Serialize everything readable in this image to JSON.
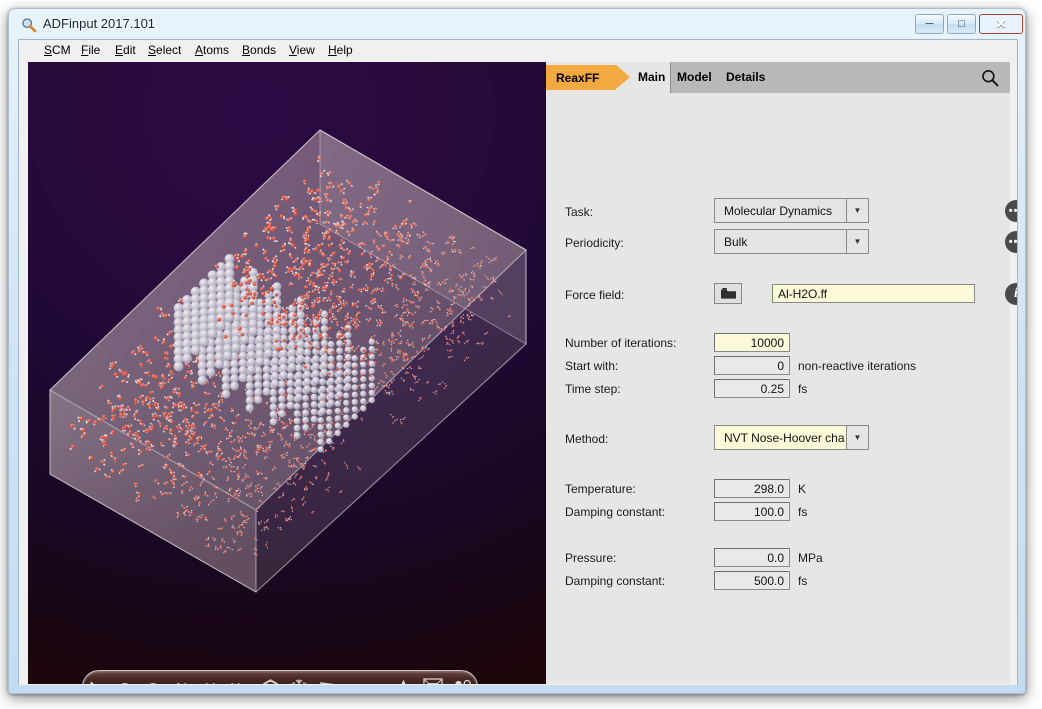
{
  "window": {
    "title": "ADFinput 2017.101",
    "icon": "magnifier-app-icon",
    "minimize_label": "─",
    "maximize_label": "□",
    "close_label": "✕"
  },
  "menubar": {
    "items": [
      {
        "name": "scm",
        "pre": "S",
        "rest": "CM"
      },
      {
        "name": "file",
        "pre": "F",
        "rest": "ile"
      },
      {
        "name": "edit",
        "pre": "E",
        "rest": "dit"
      },
      {
        "name": "select",
        "pre": "S",
        "rest": "elect"
      },
      {
        "name": "atoms",
        "pre": "A",
        "rest": "toms"
      },
      {
        "name": "bonds",
        "pre": "B",
        "rest": "onds"
      },
      {
        "name": "view",
        "pre": "V",
        "rest": "iew"
      },
      {
        "name": "help",
        "pre": "H",
        "rest": "elp"
      }
    ]
  },
  "viewport": {
    "toolbar": {
      "items": [
        {
          "name": "select-cursor-tool",
          "label": "",
          "icon": "cursor-arrow-icon"
        },
        {
          "name": "carbon-tool",
          "label": "C",
          "icon": "letter-c-icon"
        },
        {
          "name": "oxygen-tool",
          "label": "O",
          "icon": "letter-o-icon"
        },
        {
          "name": "nitrogen-tool",
          "label": "N",
          "icon": "letter-n-icon"
        },
        {
          "name": "hydrogen-tool",
          "label": "H",
          "icon": "letter-h-icon"
        },
        {
          "name": "other-element-tool",
          "label": "X",
          "icon": "letter-x-dropdown-icon"
        },
        {
          "name": "ring-tool",
          "label": "",
          "icon": "hexagon-ring-icon"
        },
        {
          "name": "crystal-tool",
          "label": "",
          "icon": "snowflake-icon"
        },
        {
          "name": "plane-tool",
          "label": "",
          "icon": "parallelogram-plane-icon"
        },
        {
          "name": "favorites-tool",
          "label": "",
          "icon": "star-icon"
        },
        {
          "name": "box-tool",
          "label": "",
          "icon": "cube-box-icon"
        },
        {
          "name": "atoms-dots-tool",
          "label": "",
          "icon": "four-dots-icon"
        }
      ]
    },
    "scene": {
      "description": "molecular-dynamics-cell",
      "background_top": "#2d0a44",
      "background_bottom": "#1d0709",
      "cell_color": "#a9939e"
    }
  },
  "panel": {
    "tag": {
      "label": "ReaxFF",
      "color": "#f2a93f"
    },
    "tabs": [
      {
        "name": "tab-main",
        "label": "Main",
        "active": true
      },
      {
        "name": "tab-model",
        "label": "Model",
        "active": false
      },
      {
        "name": "tab-details",
        "label": "Details",
        "active": false
      }
    ],
    "search_icon": "search-icon",
    "form": {
      "task": {
        "label": "Task:",
        "value": "Molecular Dynamics",
        "more_button": "•••"
      },
      "periodicity": {
        "label": "Periodicity:",
        "value": "Bulk",
        "more_button": "•••"
      },
      "force_field": {
        "label": "Force field:",
        "value": "Al-H2O.ff",
        "browse_icon": "folder-icon",
        "info_button": "i"
      },
      "iterations": {
        "label": "Number of iterations:",
        "value": "10000",
        "highlighted": true
      },
      "start_with": {
        "label": "Start with:",
        "value": "0",
        "unit": "non-reactive iterations"
      },
      "time_step": {
        "label": "Time step:",
        "value": "0.25",
        "unit": "fs"
      },
      "method": {
        "label": "Method:",
        "value": "NVT Nose-Hoover cha",
        "highlighted": true
      },
      "temperature": {
        "label": "Temperature:",
        "value": "298.0",
        "unit": "K"
      },
      "temp_damping": {
        "label": "Damping constant:",
        "value": "100.0",
        "unit": "fs"
      },
      "pressure": {
        "label": "Pressure:",
        "value": "0.0",
        "unit": "MPa"
      },
      "pressure_damping": {
        "label": "Damping constant:",
        "value": "500.0",
        "unit": "fs"
      }
    }
  }
}
